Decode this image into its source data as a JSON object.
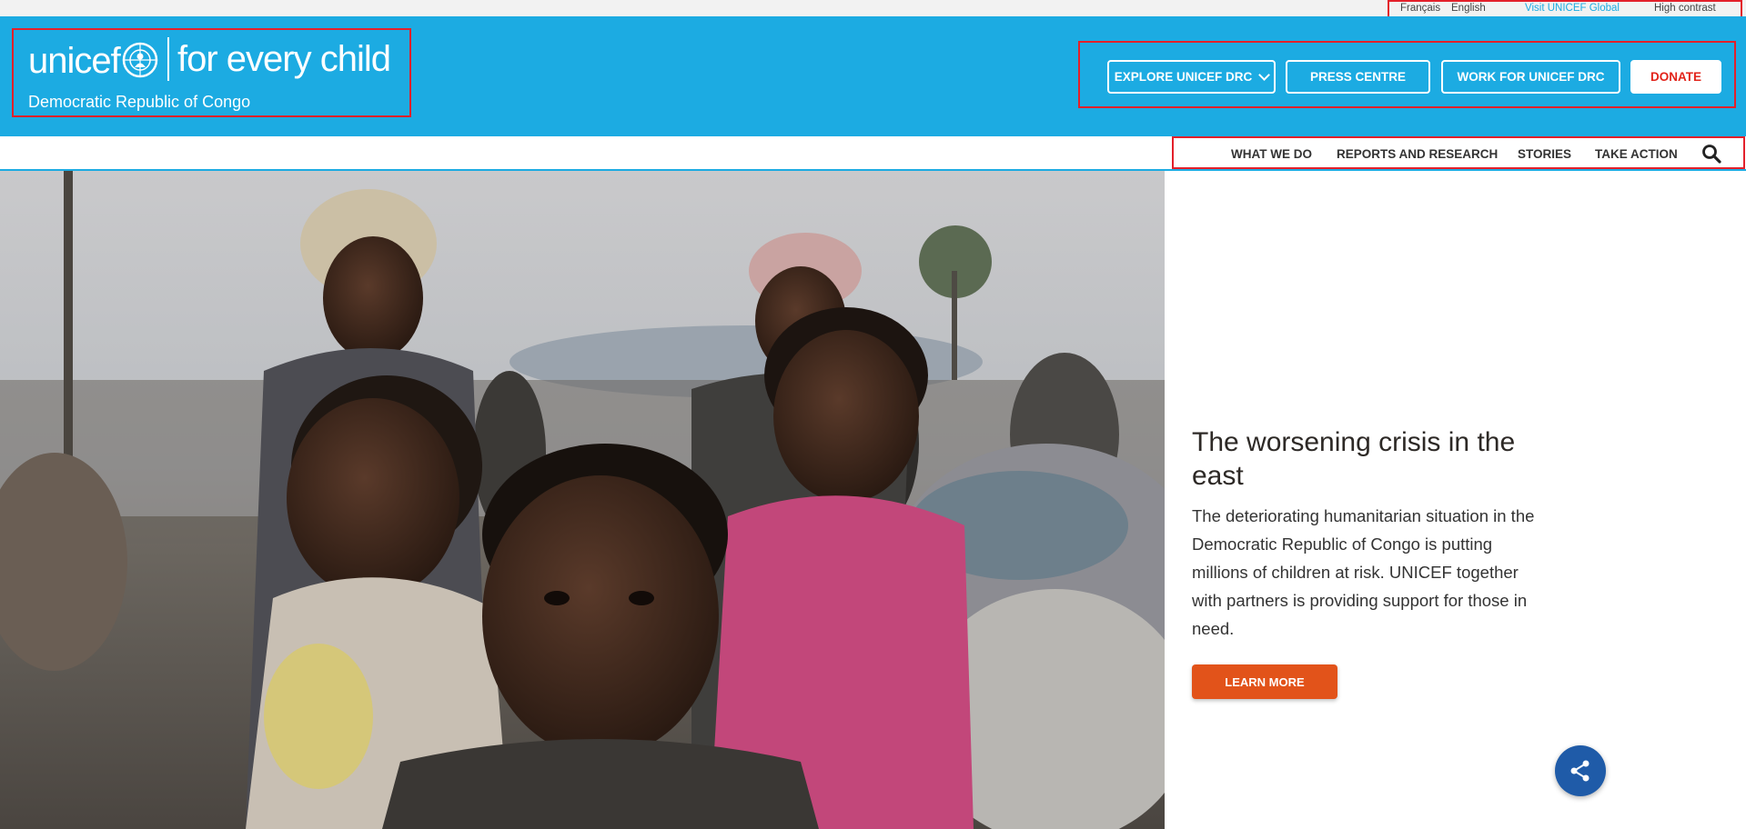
{
  "utility": {
    "links": [
      {
        "label": "Français"
      },
      {
        "label": "English"
      },
      {
        "label": "Visit UNICEF Global"
      },
      {
        "label": "High contrast"
      }
    ]
  },
  "header": {
    "logo_word": "unicef",
    "tagline": "for every child",
    "country": "Democratic Republic of Congo",
    "buttons": {
      "explore": "EXPLORE UNICEF DRC",
      "press": "PRESS CENTRE",
      "work": "WORK FOR UNICEF DRC",
      "donate": "DONATE"
    }
  },
  "nav": {
    "items": [
      {
        "label": "WHAT WE DO"
      },
      {
        "label": "REPORTS AND RESEARCH"
      },
      {
        "label": "STORIES"
      },
      {
        "label": "TAKE ACTION"
      }
    ]
  },
  "hero": {
    "title": "The worsening crisis in the east",
    "body": "The deteriorating humanitarian situation in the Democratic Republic of Congo is putting millions of children at risk. UNICEF together with partners is providing support for those in need.",
    "cta": "LEARN MORE"
  },
  "colors": {
    "brand_blue": "#1cabe2",
    "donate_red": "#e2231a",
    "cta_orange": "#e2531a",
    "share_blue": "#1f5ba8",
    "highlight_red": "#e3202a"
  },
  "icons": {
    "explore_dropdown": "chevron-down-icon",
    "search": "search-icon",
    "share": "share-icon",
    "emblem": "unicef-emblem-icon"
  }
}
